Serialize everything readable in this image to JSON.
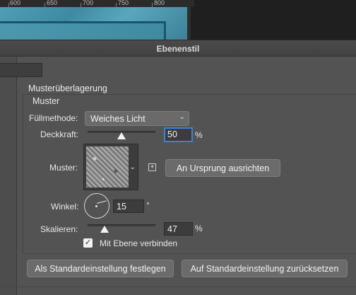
{
  "workspace": {
    "ruler_ticks": [
      "600",
      "650",
      "700",
      "750",
      "800"
    ]
  },
  "dialog": {
    "title": "Ebenenstil"
  },
  "section": {
    "title": "Musterüberlagerung",
    "group_title": "Muster"
  },
  "blend_mode": {
    "label": "Füllmethode:",
    "value": "Weiches Licht",
    "chevron_icon": "chevron-down-icon"
  },
  "opacity": {
    "label": "Deckkraft:",
    "value": "50",
    "unit": "%",
    "slider_fraction": 0.5
  },
  "pattern": {
    "label": "Muster:",
    "new_preset_icon": "plus-square-icon",
    "snap_button": "An Ursprung ausrichten"
  },
  "angle": {
    "label": "Winkel:",
    "value": "15",
    "unit": "°"
  },
  "scale": {
    "label": "Skalieren:",
    "value": "47",
    "unit": "%",
    "slider_fraction": 0.25
  },
  "link_layer": {
    "label": "Mit Ebene verbinden",
    "checked": true
  },
  "buttons": {
    "make_default": "Als Standardeinstellung festlegen",
    "reset_default": "Auf Standardeinstellung zurücksetzen"
  },
  "colors": {
    "focus_accent": "#3b82d6",
    "dialog_bg": "#535353",
    "canvas_teal": "#4f9eb5"
  }
}
